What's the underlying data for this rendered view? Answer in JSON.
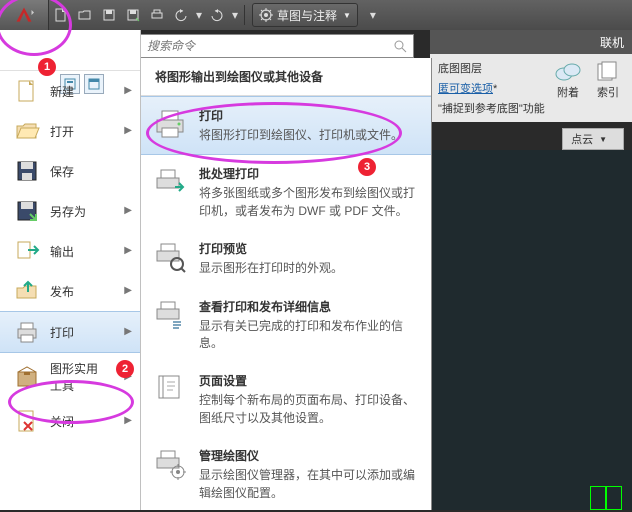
{
  "toolbar": {
    "workspace_label": "草图与注释"
  },
  "search": {
    "placeholder": "搜索命令"
  },
  "right": {
    "title_suffix": "联机",
    "line1": "底图图层",
    "line2_prefix": "匿可变选项",
    "line3": "\"捕捉到参考底图\"功能",
    "btn_attach": "附着",
    "btn_index": "索引",
    "pointcloud": "点云"
  },
  "appmenu": {
    "items": [
      {
        "label": "新建",
        "has_sub": true
      },
      {
        "label": "打开",
        "has_sub": true
      },
      {
        "label": "保存",
        "has_sub": false
      },
      {
        "label": "另存为",
        "has_sub": true
      },
      {
        "label": "输出",
        "has_sub": true
      },
      {
        "label": "发布",
        "has_sub": true
      },
      {
        "label": "打印",
        "has_sub": true
      },
      {
        "label": "图形实用\n工具",
        "has_sub": true
      },
      {
        "label": "关闭",
        "has_sub": true
      }
    ]
  },
  "submenu": {
    "title": "将图形输出到绘图仪或其他设备",
    "items": [
      {
        "t": "打印",
        "d": "将图形打印到绘图仪、打印机或文件。"
      },
      {
        "t": "批处理打印",
        "d": "将多张图纸或多个图形发布到绘图仪或打印机，或者发布为 DWF 或 PDF 文件。"
      },
      {
        "t": "打印预览",
        "d": "显示图形在打印时的外观。"
      },
      {
        "t": "查看打印和发布详细信息",
        "d": "显示有关已完成的打印和发布作业的信息。"
      },
      {
        "t": "页面设置",
        "d": "控制每个新布局的页面布局、打印设备、图纸尺寸以及其他设置。"
      },
      {
        "t": "管理绘图仪",
        "d": "显示绘图仪管理器，在其中可以添加或编辑绘图仪配置。"
      }
    ]
  },
  "annotations": {
    "b1": "1",
    "b2": "2",
    "b3": "3"
  }
}
